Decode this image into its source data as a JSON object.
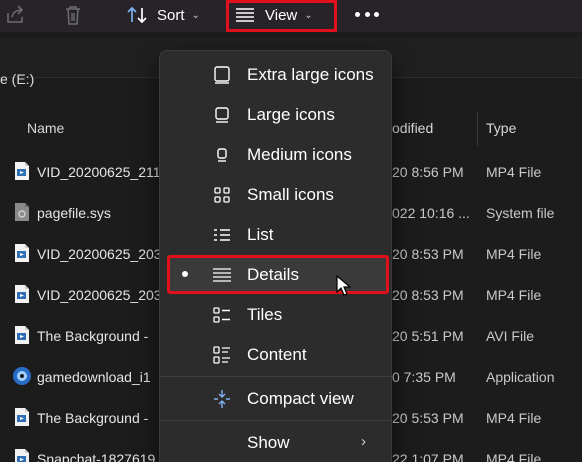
{
  "toolbar": {
    "share_icon": "share-icon",
    "delete_icon": "trash-icon",
    "sort_label": "Sort",
    "view_label": "View",
    "more_icon": "ellipsis-icon",
    "highlight_color": "#e0101c"
  },
  "address": {
    "path_fragment": "e (E:)"
  },
  "columns": {
    "name": "Name",
    "date_fragment": "odified",
    "type": "Type"
  },
  "files": [
    {
      "name": "VID_20200625_211",
      "date": "20 8:56 PM",
      "type": "MP4 File",
      "icon": "video-file-icon"
    },
    {
      "name": "pagefile.sys",
      "date": "022 10:16 ...",
      "type": "System file",
      "icon": "system-file-icon"
    },
    {
      "name": "VID_20200625_203",
      "date": "20 8:53 PM",
      "type": "MP4 File",
      "icon": "video-file-icon"
    },
    {
      "name": "VID_20200625_203",
      "date": "20 8:53 PM",
      "type": "MP4 File",
      "icon": "video-file-icon"
    },
    {
      "name": "The Background -",
      "date": "20 5:51 PM",
      "type": "AVI File",
      "icon": "video-file-icon"
    },
    {
      "name": "gamedownload_i1",
      "date": "0 7:35 PM",
      "type": "Application",
      "icon": "application-icon"
    },
    {
      "name": "The Background -",
      "date": "20 5:53 PM",
      "type": "MP4 File",
      "icon": "video-file-icon"
    },
    {
      "name": "Snapchat-1827619",
      "date": "22 1:07 PM",
      "type": "MP4 File",
      "icon": "video-file-icon"
    }
  ],
  "view_menu": {
    "items": [
      {
        "label": "Extra large icons",
        "icon": "extra-large-icons-icon"
      },
      {
        "label": "Large icons",
        "icon": "large-icons-icon"
      },
      {
        "label": "Medium icons",
        "icon": "medium-icons-icon"
      },
      {
        "label": "Small icons",
        "icon": "small-icons-icon"
      },
      {
        "label": "List",
        "icon": "list-view-icon"
      },
      {
        "label": "Details",
        "icon": "details-view-icon",
        "selected": true
      },
      {
        "label": "Tiles",
        "icon": "tiles-view-icon"
      },
      {
        "label": "Content",
        "icon": "content-view-icon"
      },
      {
        "label": "Compact view",
        "icon": "compact-view-icon"
      },
      {
        "label": "Show",
        "icon": "chevron-right-icon"
      }
    ]
  }
}
